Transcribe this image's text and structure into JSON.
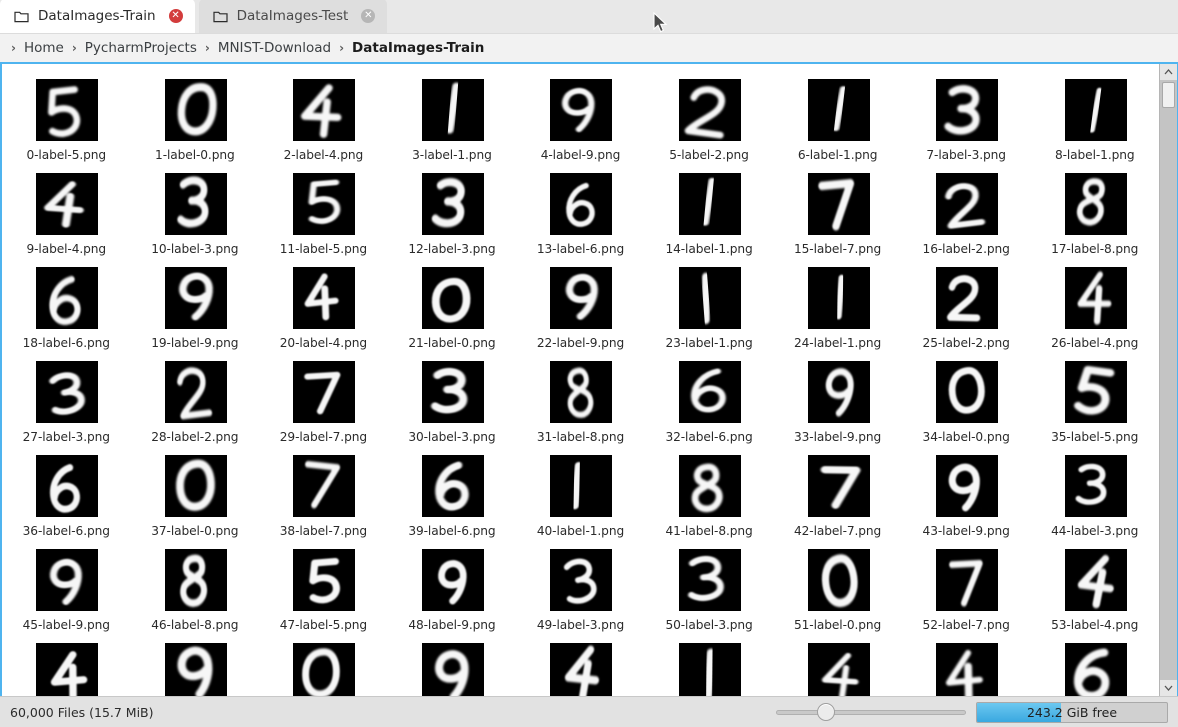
{
  "window": {
    "title": "DataImages-Train",
    "accent_color": "#4fb4ef",
    "tab_active_bg": "#ffffff",
    "tab_inactive_bg": "#dedede"
  },
  "tabs": [
    {
      "label": "DataImages-Train",
      "active": true,
      "icon": "folder-icon",
      "close_icon": "close-icon",
      "close_color": "#d33c3c"
    },
    {
      "label": "DataImages-Test",
      "active": false,
      "icon": "folder-icon",
      "close_icon": "close-icon",
      "close_color": "#b6b6b6"
    }
  ],
  "breadcrumb": {
    "leading_separator": "›",
    "separator": "›",
    "items": [
      {
        "label": "Home",
        "current": false
      },
      {
        "label": "PycharmProjects",
        "current": false
      },
      {
        "label": "MNIST-Download",
        "current": false
      },
      {
        "label": "DataImages-Train",
        "current": true
      }
    ]
  },
  "file_grid": {
    "columns": 9,
    "files": [
      {
        "name": "0-label-5.png",
        "index": 0,
        "label": 5
      },
      {
        "name": "1-label-0.png",
        "index": 1,
        "label": 0
      },
      {
        "name": "2-label-4.png",
        "index": 2,
        "label": 4
      },
      {
        "name": "3-label-1.png",
        "index": 3,
        "label": 1
      },
      {
        "name": "4-label-9.png",
        "index": 4,
        "label": 9
      },
      {
        "name": "5-label-2.png",
        "index": 5,
        "label": 2
      },
      {
        "name": "6-label-1.png",
        "index": 6,
        "label": 1
      },
      {
        "name": "7-label-3.png",
        "index": 7,
        "label": 3
      },
      {
        "name": "8-label-1.png",
        "index": 8,
        "label": 1
      },
      {
        "name": "9-label-4.png",
        "index": 9,
        "label": 4
      },
      {
        "name": "10-label-3.png",
        "index": 10,
        "label": 3
      },
      {
        "name": "11-label-5.png",
        "index": 11,
        "label": 5
      },
      {
        "name": "12-label-3.png",
        "index": 12,
        "label": 3
      },
      {
        "name": "13-label-6.png",
        "index": 13,
        "label": 6
      },
      {
        "name": "14-label-1.png",
        "index": 14,
        "label": 1
      },
      {
        "name": "15-label-7.png",
        "index": 15,
        "label": 7
      },
      {
        "name": "16-label-2.png",
        "index": 16,
        "label": 2
      },
      {
        "name": "17-label-8.png",
        "index": 17,
        "label": 8
      },
      {
        "name": "18-label-6.png",
        "index": 18,
        "label": 6
      },
      {
        "name": "19-label-9.png",
        "index": 19,
        "label": 9
      },
      {
        "name": "20-label-4.png",
        "index": 20,
        "label": 4
      },
      {
        "name": "21-label-0.png",
        "index": 21,
        "label": 0
      },
      {
        "name": "22-label-9.png",
        "index": 22,
        "label": 9
      },
      {
        "name": "23-label-1.png",
        "index": 23,
        "label": 1
      },
      {
        "name": "24-label-1.png",
        "index": 24,
        "label": 1
      },
      {
        "name": "25-label-2.png",
        "index": 25,
        "label": 2
      },
      {
        "name": "26-label-4.png",
        "index": 26,
        "label": 4
      },
      {
        "name": "27-label-3.png",
        "index": 27,
        "label": 3
      },
      {
        "name": "28-label-2.png",
        "index": 28,
        "label": 2
      },
      {
        "name": "29-label-7.png",
        "index": 29,
        "label": 7
      },
      {
        "name": "30-label-3.png",
        "index": 30,
        "label": 3
      },
      {
        "name": "31-label-8.png",
        "index": 31,
        "label": 8
      },
      {
        "name": "32-label-6.png",
        "index": 32,
        "label": 6
      },
      {
        "name": "33-label-9.png",
        "index": 33,
        "label": 9
      },
      {
        "name": "34-label-0.png",
        "index": 34,
        "label": 0
      },
      {
        "name": "35-label-5.png",
        "index": 35,
        "label": 5
      },
      {
        "name": "36-label-6.png",
        "index": 36,
        "label": 6
      },
      {
        "name": "37-label-0.png",
        "index": 37,
        "label": 0
      },
      {
        "name": "38-label-7.png",
        "index": 38,
        "label": 7
      },
      {
        "name": "39-label-6.png",
        "index": 39,
        "label": 6
      },
      {
        "name": "40-label-1.png",
        "index": 40,
        "label": 1
      },
      {
        "name": "41-label-8.png",
        "index": 41,
        "label": 8
      },
      {
        "name": "42-label-7.png",
        "index": 42,
        "label": 7
      },
      {
        "name": "43-label-9.png",
        "index": 43,
        "label": 9
      },
      {
        "name": "44-label-3.png",
        "index": 44,
        "label": 3
      },
      {
        "name": "45-label-9.png",
        "index": 45,
        "label": 9
      },
      {
        "name": "46-label-8.png",
        "index": 46,
        "label": 8
      },
      {
        "name": "47-label-5.png",
        "index": 47,
        "label": 5
      },
      {
        "name": "48-label-9.png",
        "index": 48,
        "label": 9
      },
      {
        "name": "49-label-3.png",
        "index": 49,
        "label": 3
      },
      {
        "name": "50-label-3.png",
        "index": 50,
        "label": 3
      },
      {
        "name": "51-label-0.png",
        "index": 51,
        "label": 0
      },
      {
        "name": "52-label-7.png",
        "index": 52,
        "label": 7
      },
      {
        "name": "53-label-4.png",
        "index": 53,
        "label": 4
      },
      {
        "name": "",
        "index": 54,
        "label": 4,
        "clipped": true
      },
      {
        "name": "",
        "index": 55,
        "label": 9,
        "clipped": true
      },
      {
        "name": "",
        "index": 56,
        "label": 0,
        "clipped": true
      },
      {
        "name": "",
        "index": 57,
        "label": 9,
        "clipped": true
      },
      {
        "name": "",
        "index": 58,
        "label": 4,
        "clipped": true
      },
      {
        "name": "",
        "index": 59,
        "label": 1,
        "clipped": true
      },
      {
        "name": "",
        "index": 60,
        "label": 4,
        "clipped": true
      },
      {
        "name": "",
        "index": 61,
        "label": 4,
        "clipped": true
      },
      {
        "name": "",
        "index": 62,
        "label": 6,
        "clipped": true
      }
    ]
  },
  "scrollbar": {
    "up_arrow_icon": "chevron-up-icon",
    "down_arrow_icon": "chevron-down-icon",
    "thumb_position_pct": 1
  },
  "statusbar": {
    "files_text": "60,000 Files (15.7 MiB)",
    "disk_free_text": "243.2 GiB free",
    "disk_used_pct": 44,
    "zoom_value_pct": 23
  }
}
